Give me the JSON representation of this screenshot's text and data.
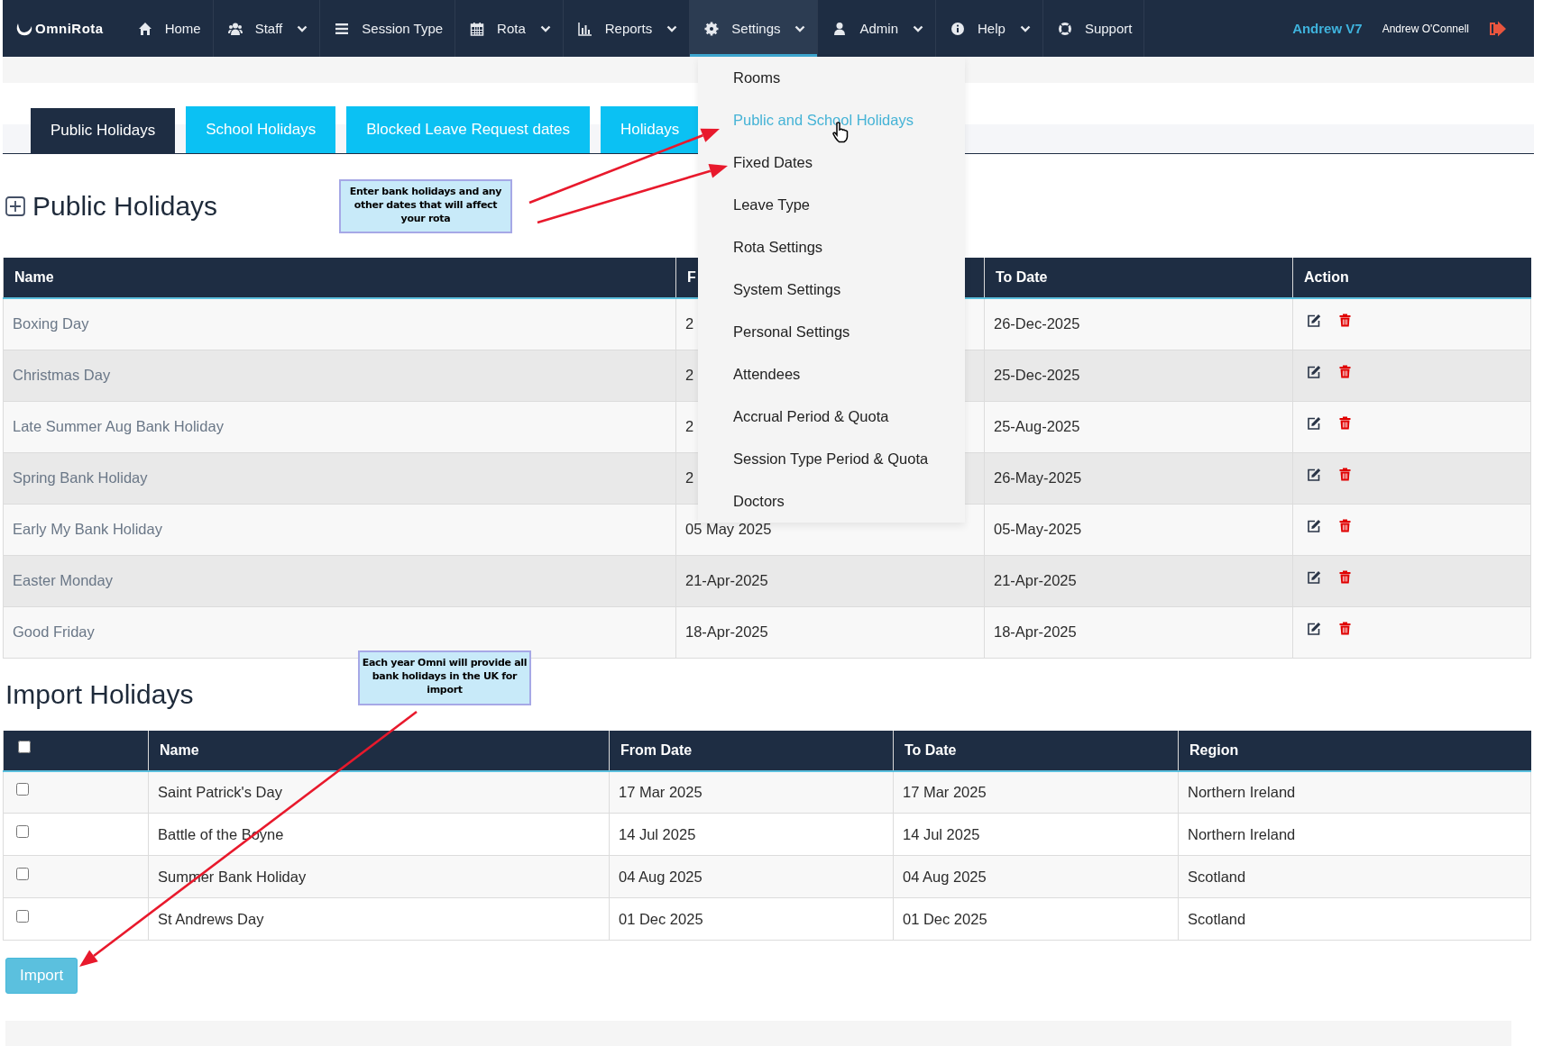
{
  "nav": {
    "logo": "OmniRota",
    "items": [
      {
        "label": "Home",
        "dropdown": false,
        "selected": false
      },
      {
        "label": "Staff",
        "dropdown": true,
        "selected": false
      },
      {
        "label": "Session Type",
        "dropdown": false,
        "selected": false
      },
      {
        "label": "Rota",
        "dropdown": true,
        "selected": false
      },
      {
        "label": "Reports",
        "dropdown": true,
        "selected": false
      },
      {
        "label": "Settings",
        "dropdown": true,
        "selected": true
      },
      {
        "label": "Admin",
        "dropdown": true,
        "selected": false
      },
      {
        "label": "Help",
        "dropdown": true,
        "selected": false
      },
      {
        "label": "Support",
        "dropdown": false,
        "selected": false
      }
    ],
    "workspace": "Andrew V7",
    "user_name": "Andrew O'Connell"
  },
  "settings_menu": {
    "items": [
      {
        "label": "Rooms",
        "hovered": false
      },
      {
        "label": "Public and School Holidays",
        "hovered": true
      },
      {
        "label": "Fixed Dates",
        "hovered": false
      },
      {
        "label": "Leave Type",
        "hovered": false
      },
      {
        "label": "Rota Settings",
        "hovered": false
      },
      {
        "label": "System Settings",
        "hovered": false
      },
      {
        "label": "Personal Settings",
        "hovered": false
      },
      {
        "label": "Attendees",
        "hovered": false
      },
      {
        "label": "Accrual Period & Quota",
        "hovered": false
      },
      {
        "label": "Session Type Period & Quota",
        "hovered": false
      },
      {
        "label": "Doctors",
        "hovered": false
      }
    ]
  },
  "tabs": [
    {
      "label": "Public Holidays",
      "selected": true
    },
    {
      "label": "School Holidays",
      "selected": false
    },
    {
      "label": "Blocked Leave Request dates",
      "selected": false
    },
    {
      "label": "Holidays",
      "selected": false
    }
  ],
  "public_holidays": {
    "title": "Public Holidays",
    "columns": [
      "Name",
      "F",
      "To Date",
      "Action"
    ],
    "rows": [
      {
        "name": "Boxing Day",
        "from": "2",
        "to": "26-Dec-2025"
      },
      {
        "name": "Christmas Day",
        "from": "2",
        "to": "25-Dec-2025"
      },
      {
        "name": "Late Summer Aug Bank Holiday",
        "from": "2",
        "to": "25-Aug-2025"
      },
      {
        "name": "Spring Bank Holiday",
        "from": "2",
        "to": "26-May-2025"
      },
      {
        "name": "Early My Bank Holiday",
        "from": "05 May 2025",
        "to": "05-May-2025"
      },
      {
        "name": "Easter Monday",
        "from": "21-Apr-2025",
        "to": "21-Apr-2025"
      },
      {
        "name": "Good Friday",
        "from": "18-Apr-2025",
        "to": "18-Apr-2025"
      }
    ]
  },
  "callouts": [
    {
      "text": "Enter bank holidays and any other dates that will affect your rota"
    },
    {
      "text": "Each year Omni will provide all bank holidays in the UK for import"
    }
  ],
  "import_holidays": {
    "title": "Import Holidays",
    "select_all_checked": false,
    "columns": [
      "Name",
      "From Date",
      "To Date",
      "Region"
    ],
    "rows": [
      {
        "checked": false,
        "name": "Saint Patrick's Day",
        "from": "17 Mar 2025",
        "to": "17 Mar 2025",
        "region": "Northern Ireland"
      },
      {
        "checked": false,
        "name": "Battle of the Boyne",
        "from": "14 Jul 2025",
        "to": "14 Jul 2025",
        "region": "Northern Ireland"
      },
      {
        "checked": false,
        "name": "Summer Bank Holiday",
        "from": "04 Aug 2025",
        "to": "04 Aug 2025",
        "region": "Scotland"
      },
      {
        "checked": false,
        "name": "St Andrews Day",
        "from": "01 Dec 2025",
        "to": "01 Dec 2025",
        "region": "Scotland"
      }
    ],
    "button": "Import"
  }
}
